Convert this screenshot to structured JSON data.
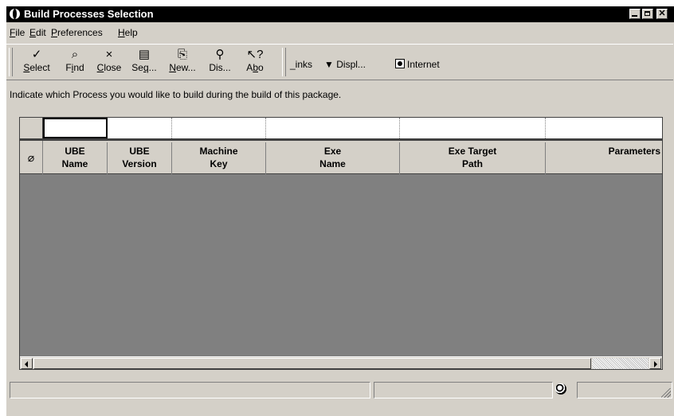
{
  "window": {
    "title": "Build Processes Selection"
  },
  "menu": [
    {
      "label": "File",
      "key": "F"
    },
    {
      "label": "Edit",
      "key": "E"
    },
    {
      "label": "Preferences",
      "key": "P"
    },
    {
      "label": "Help",
      "key": "H"
    }
  ],
  "toolbar": {
    "select": {
      "label": "Select",
      "icon": "checkmark-icon"
    },
    "find": {
      "label": "Find",
      "icon": "find-icon"
    },
    "close": {
      "label": "Close",
      "icon": "x-icon"
    },
    "seq": {
      "label": "Seq...",
      "icon": "document-icon"
    },
    "new": {
      "label": "New...",
      "icon": "new-icon"
    },
    "dis": {
      "label": "Dis...",
      "icon": "display-icon"
    },
    "abo": {
      "label": "Abo",
      "icon": "help-pointer-icon"
    },
    "links": "_inks",
    "displ": "Displ...",
    "internet": "Internet"
  },
  "instruction": "Indicate which Process you would like to build during the build of this package.",
  "grid": {
    "columns": [
      {
        "line1": "UBE",
        "line2": "Name"
      },
      {
        "line1": "UBE",
        "line2": "Version"
      },
      {
        "line1": "Machine",
        "line2": "Key"
      },
      {
        "line1": "Exe",
        "line2": "Name"
      },
      {
        "line1": "Exe Target",
        "line2": "Path"
      },
      {
        "line1": "Parameters",
        "line2": ""
      }
    ],
    "rows": []
  },
  "status": {
    "panel1": "",
    "panel2": "",
    "panel3": ""
  }
}
